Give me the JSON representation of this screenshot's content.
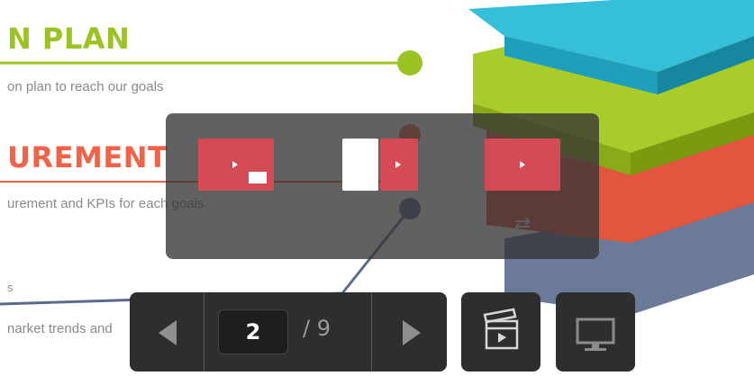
{
  "slide": {
    "heading1": "N PLAN",
    "subtitle1": "on plan to reach our goals",
    "heading2": "UREMENT",
    "subtitle2": "urement and KPIs for each goals",
    "subtitle3_fragment": "s",
    "subtitle4": "narket trends and",
    "colors": {
      "green": "#9cc324",
      "red": "#f06349",
      "blue": "#5b6b8c",
      "cyan": "#2fb6d1"
    }
  },
  "layout_panel": {
    "options": [
      {
        "name": "picture-in-picture",
        "icon": "pip-layout-icon"
      },
      {
        "name": "side-by-side",
        "icon": "split-layout-icon"
      },
      {
        "name": "video-only",
        "icon": "video-only-icon"
      }
    ],
    "swap_glyph": "⇄"
  },
  "navigation": {
    "current_page": "2",
    "total_pages": "/ 9",
    "prev_icon": "triangle-left-icon",
    "next_icon": "triangle-right-icon"
  },
  "toolbar": {
    "media_icon": "clapperboard-icon",
    "screen_icon": "monitor-icon"
  }
}
